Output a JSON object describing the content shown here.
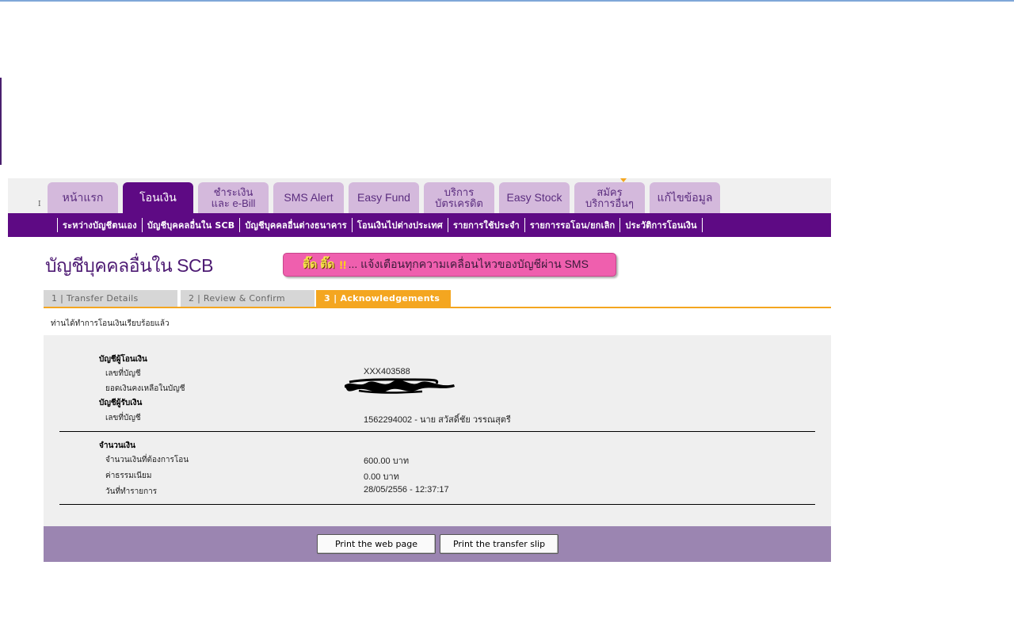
{
  "tabs": [
    {
      "label": "หน้าแรก"
    },
    {
      "label": "โอนเงิน"
    },
    {
      "label": "ชำระเงิน\nและ e-Bill"
    },
    {
      "label": "SMS Alert"
    },
    {
      "label": "Easy Fund"
    },
    {
      "label": "บริการ\nบัตรเครดิต"
    },
    {
      "label": "Easy Stock"
    },
    {
      "label": "สมัคร\nบริการอื่นๆ"
    },
    {
      "label": "แก้ไขข้อมูล"
    }
  ],
  "subnav": [
    {
      "label": "ระหว่างบัญชีตนเอง"
    },
    {
      "label": "บัญชีบุคคลอื่นใน SCB"
    },
    {
      "label": "บัญชีบุคคลอื่นต่างธนาคาร"
    },
    {
      "label": "โอนเงินไปต่างประเทศ"
    },
    {
      "label": "รายการใช้ประจำ"
    },
    {
      "label": "รายการรอโอน/ยกเลิก"
    },
    {
      "label": "ประวัติการโอนเงิน"
    }
  ],
  "page": {
    "title": "บัญชีบุคคลอื่นใน SCB",
    "banner_highlight": "ติ๊ด ติ๊ด",
    "banner_excl": "!!",
    "banner_text": "... แจ้งเตือนทุกความเคลื่อนไหวของบัญชีผ่าน SMS"
  },
  "steps": [
    {
      "label": "1 | Transfer Details"
    },
    {
      "label": "2 | Review & Confirm"
    },
    {
      "label": "3 | Acknowledgements"
    }
  ],
  "notice": "ท่านได้ทำการโอนเงินเรียบร้อยแล้ว",
  "details": {
    "from_heading": "บัญชีผู้โอนเงิน",
    "from_account_label": "เลขที่บัญชี",
    "from_account_value": "XXX403588",
    "from_balance_label": "ยอดเงินคงเหลือในบัญชี",
    "to_heading": "บัญชีผู้รับเงิน",
    "to_account_label": "เลขที่บัญชี",
    "to_account_value": "1562294002 - นาย สวัสดิ์ชัย วรรณสุตรี",
    "amount_heading": "จำนวนเงิน",
    "amount_label": "จำนวนเงินที่ต้องการโอน",
    "amount_value": "600.00 บาท",
    "fee_label": "ค่าธรรมเนียม",
    "fee_value": "0.00  บาท",
    "date_label": "วันที่ทำรายการ",
    "date_value": "28/05/2556 - 12:37:17"
  },
  "buttons": {
    "print_web": "Print the web page",
    "print_slip": "Print the transfer slip"
  },
  "colors": {
    "brand_purple": "#5e0a84",
    "tab_inactive": "#d4b9dc",
    "accent_orange": "#f4a620",
    "button_bar": "#9b85b1"
  }
}
